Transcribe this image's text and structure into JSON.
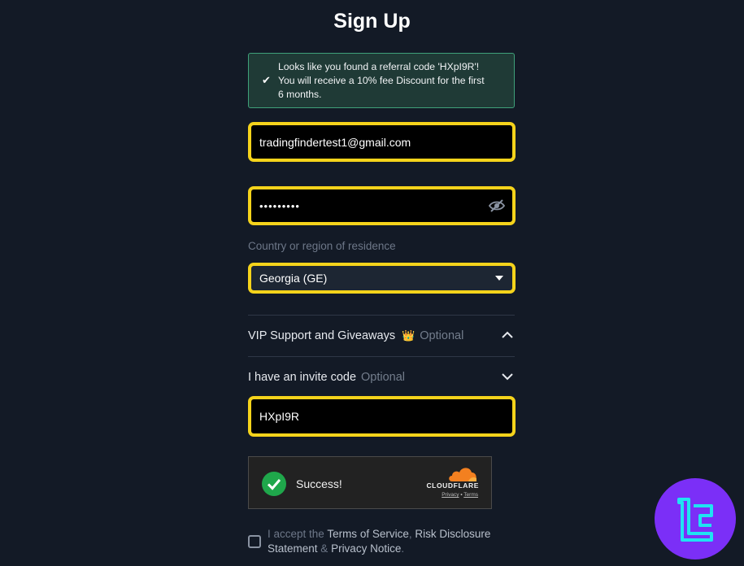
{
  "title": "Sign Up",
  "referral": {
    "line1": "Looks like you found a referral code 'HXpI9R'!",
    "line2": "You will receive a 10% fee Discount for the first",
    "line3": "6 months."
  },
  "email": {
    "value": "tradingfindertest1@gmail.com"
  },
  "password": {
    "masked_value": "•••••••••"
  },
  "country": {
    "label": "Country or region of residence",
    "value": "Georgia (GE)"
  },
  "vip": {
    "label": "VIP Support and Giveaways",
    "crown": "👑",
    "optional": "Optional"
  },
  "invite": {
    "label": "I have an invite code",
    "optional": "Optional",
    "value": "HXpI9R"
  },
  "captcha": {
    "status": "Success!",
    "brand": "CLOUDFLARE",
    "privacy": "Privacy",
    "sep": "•",
    "terms": "Terms"
  },
  "accept": {
    "prefix": "I accept the ",
    "terms": "Terms of Service",
    "comma": ", ",
    "risk": "Risk Disclosure Statement",
    "amp": " & ",
    "privacy": "Privacy Notice",
    "period": "."
  },
  "colors": {
    "highlight": "#f5d31b",
    "background": "#131a26",
    "success": "#1fa74b",
    "logo": "#7b2ff7"
  }
}
